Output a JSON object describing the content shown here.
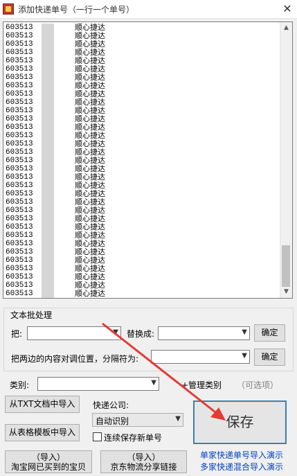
{
  "window": {
    "title": "添加快递单号（一行一个单号）",
    "close_label": "✕"
  },
  "list": {
    "carrier": "顺心捷达",
    "rows": [
      "603513",
      "603513",
      "603513",
      "603513",
      "603513",
      "603513",
      "603513",
      "603513",
      "603513",
      "603513",
      "603513",
      "603513",
      "603513",
      "603513",
      "603513",
      "603513",
      "603513",
      "603513",
      "603513",
      "603513",
      "603513",
      "603513",
      "603513",
      "603513",
      "603513",
      "603513",
      "603513",
      "603513",
      "603513",
      "603513",
      "603513",
      "603513",
      "603513"
    ]
  },
  "batch": {
    "group_title": "文本批处理",
    "from_label": "把:",
    "replace_label": "替换成:",
    "confirm_label": "确定",
    "swap_label": "把两边的内容对调位置，分隔符为:",
    "confirm2_label": "确定"
  },
  "category": {
    "label": "类别:",
    "manage_label": "+管理类别",
    "optional": "（可选项）"
  },
  "buttons": {
    "import_txt": "从TXT文档中导入",
    "import_table": "从表格模板中导入",
    "import_taobao_1": "（导入）",
    "import_taobao_2": "淘宝网已买到的宝贝",
    "import_jd_1": "（导入）",
    "import_jd_2": "京东物流分享链接",
    "save": "保存"
  },
  "courier": {
    "label": "快递公司:",
    "value": "自动识别",
    "continuous_save": "连续保存新单号"
  },
  "links": {
    "single_demo": "单家快递单号导入演示",
    "multi_demo": "多家快递混合导入演示"
  },
  "annotation_color": "#e53935"
}
